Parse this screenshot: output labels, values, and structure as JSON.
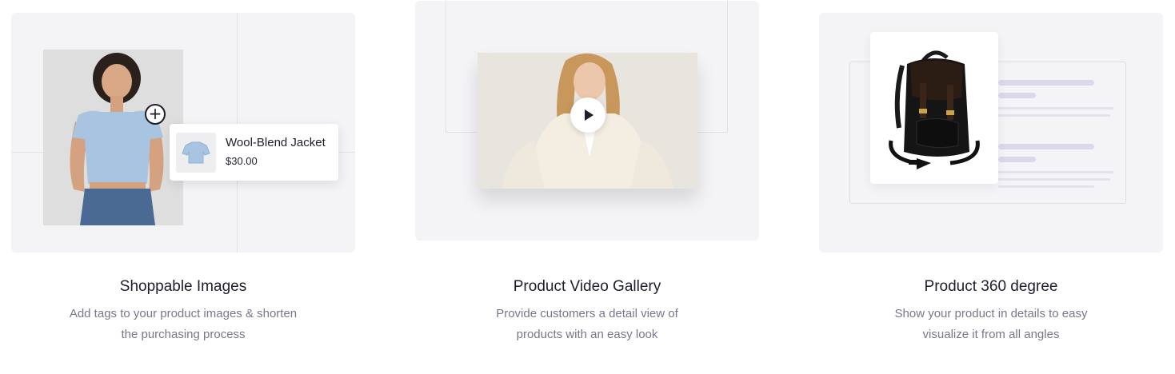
{
  "features": [
    {
      "title": "Shoppable Images",
      "description_lines": [
        "Add tags to your product images & shorten",
        "the purchasing process"
      ],
      "tag": {
        "name": "Wool-Blend Jacket",
        "price": "$30.00"
      },
      "icons": [
        "plus-icon"
      ]
    },
    {
      "title": "Product Video Gallery",
      "description_lines": [
        "Provide customers a detail view of",
        "products with an easy look"
      ],
      "icons": [
        "play-icon"
      ]
    },
    {
      "title": "Product 360 degree",
      "description_lines": [
        "Show your product in details to easy",
        "visualize it from all angles"
      ],
      "icons": [
        "rotate-360-icon"
      ]
    }
  ],
  "colors": {
    "card_background": "#f4f3f6",
    "heading": "#1d1d2c",
    "body_text": "#777889",
    "placeholder_bar": "#dcd8ea"
  }
}
